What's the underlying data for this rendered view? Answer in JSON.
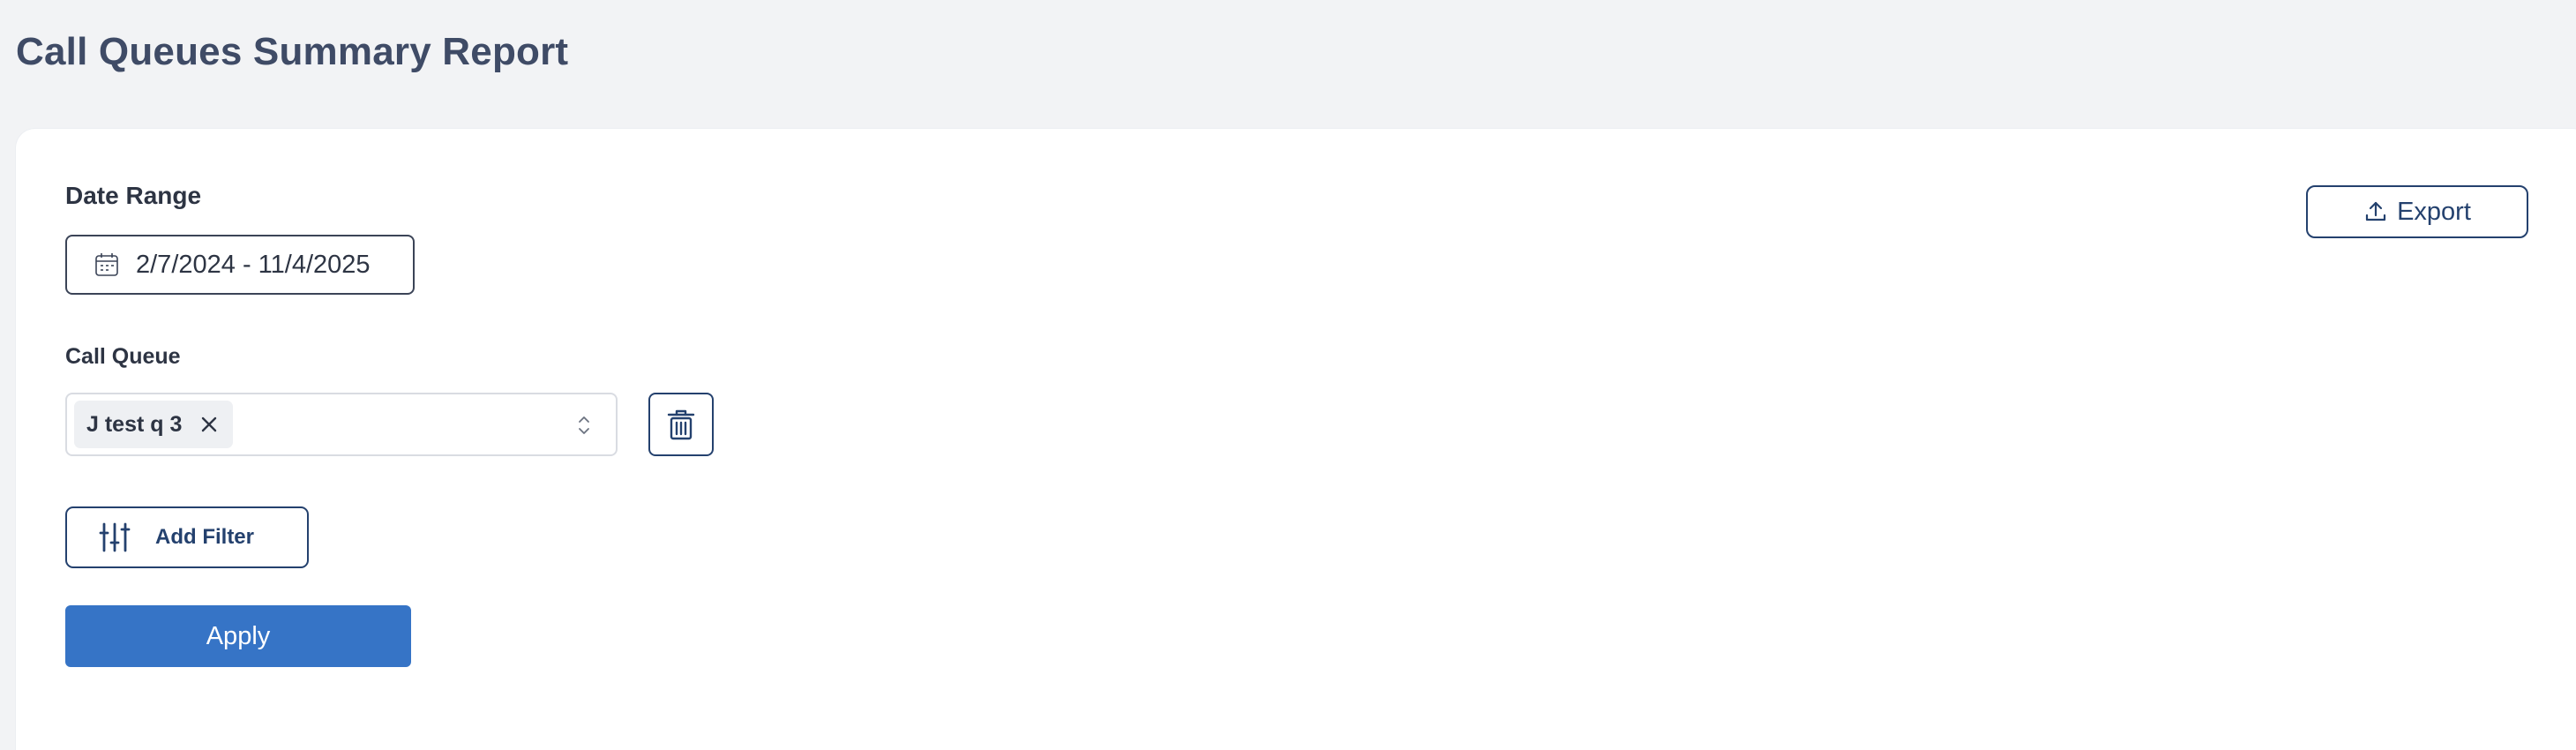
{
  "header": {
    "title": "Call Queues Summary Report"
  },
  "filters": {
    "date_range": {
      "label": "Date Range",
      "value": "2/7/2024 - 11/4/2025",
      "icon": "calendar-icon"
    },
    "call_queue": {
      "label": "Call Queue",
      "selected": [
        {
          "label": "J test q 3"
        }
      ],
      "remove_icon": "close-icon",
      "arrows_icon": "chevron-up-down-icon"
    },
    "delete_icon": "trash-icon",
    "add_filter": {
      "label": "Add Filter",
      "icon": "sliders-icon"
    },
    "apply": {
      "label": "Apply"
    }
  },
  "toolbar": {
    "export_label": "Export",
    "export_icon": "upload-icon"
  },
  "colors": {
    "title": "#3f4b66",
    "navy": "#24416e",
    "apply_bg": "#3674c6",
    "page_bg": "#f2f3f5",
    "panel_bg": "#ffffff"
  }
}
